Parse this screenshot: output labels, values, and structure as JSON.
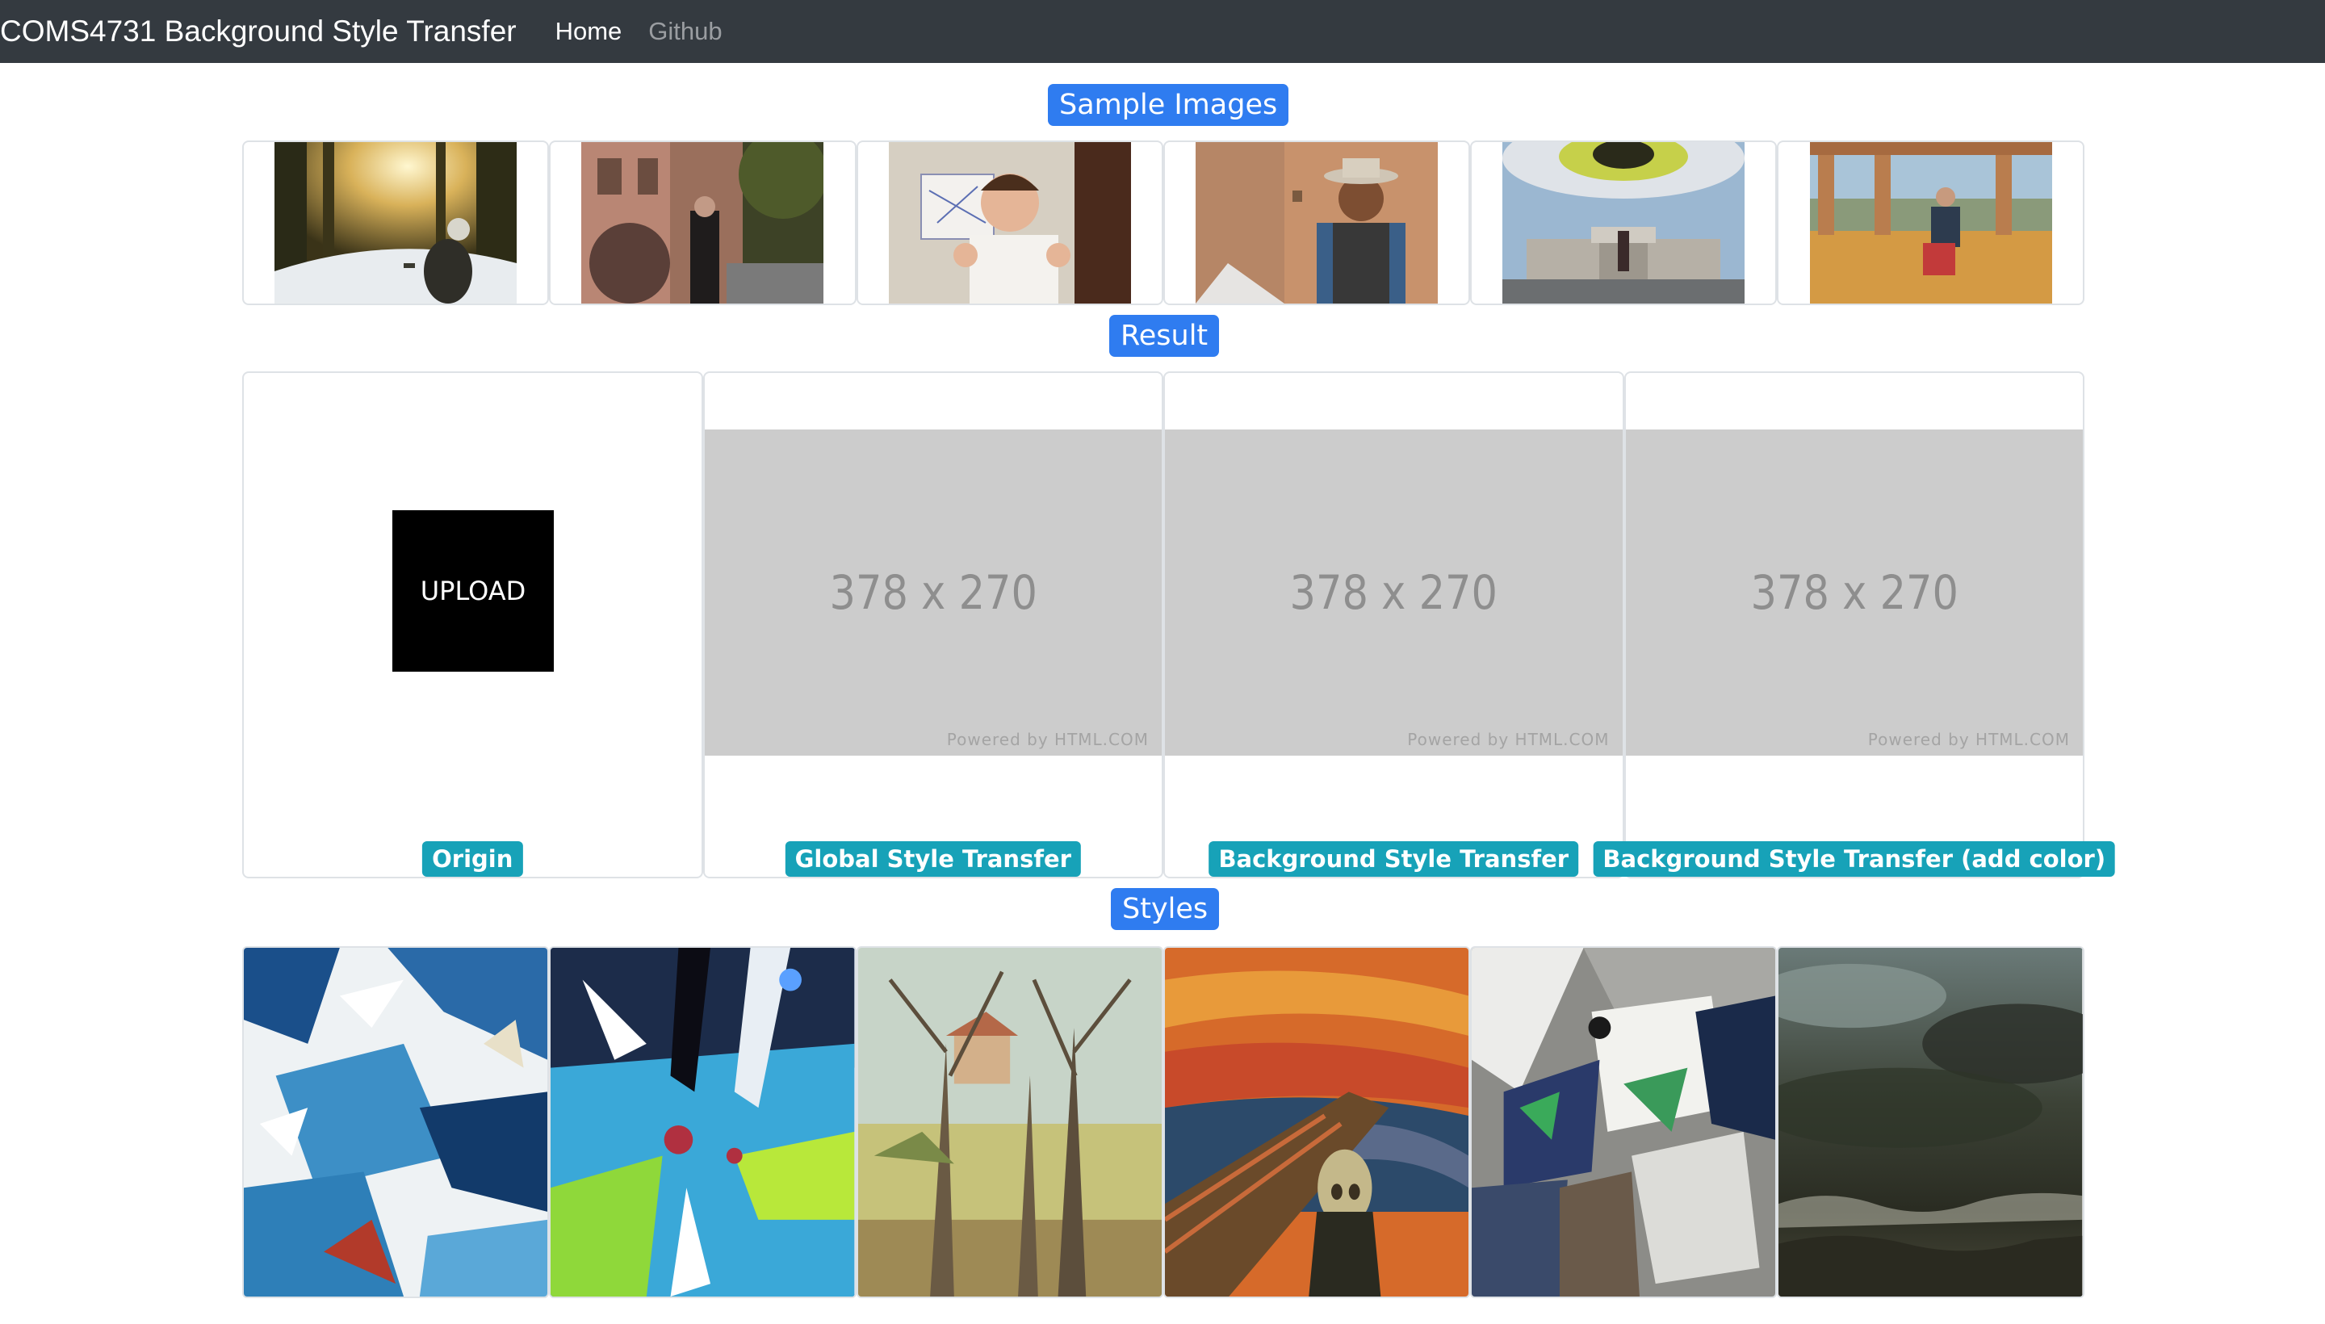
{
  "navbar": {
    "brand": "COMS4731 Background Style Transfer",
    "links": [
      {
        "label": "Home",
        "active": true
      },
      {
        "label": "Github",
        "active": false
      }
    ]
  },
  "sections": {
    "samples_title": "Sample Images",
    "result_title": "Result",
    "styles_title": "Styles"
  },
  "samples": [
    {
      "name": "sample-forest-snow"
    },
    {
      "name": "sample-street-woman"
    },
    {
      "name": "sample-boy-thumbs-up"
    },
    {
      "name": "sample-man-hat"
    },
    {
      "name": "sample-building-eye"
    },
    {
      "name": "sample-man-wall"
    }
  ],
  "result": {
    "upload_label": "UPLOAD",
    "cards": [
      {
        "caption": "Origin"
      },
      {
        "caption": "Global Style Transfer",
        "placeholder": "378 x 270",
        "powered": "Powered by HTML.COM"
      },
      {
        "caption": "Background Style Transfer",
        "placeholder": "378 x 270",
        "powered": "Powered by HTML.COM"
      },
      {
        "caption": "Background Style Transfer (add color)",
        "placeholder": "378 x 270",
        "powered": "Powered by HTML.COM"
      }
    ]
  },
  "styles": [
    {
      "name": "style-abstract-blue"
    },
    {
      "name": "style-graffiti"
    },
    {
      "name": "style-cezanne-trees"
    },
    {
      "name": "style-the-scream"
    },
    {
      "name": "style-cubist"
    },
    {
      "name": "style-courbet-wave"
    }
  ],
  "colors": {
    "navbar_bg": "#343a40",
    "primary_badge": "#2f7cf0",
    "info_badge": "#17a2b8",
    "placeholder_bg": "#cccccc"
  }
}
